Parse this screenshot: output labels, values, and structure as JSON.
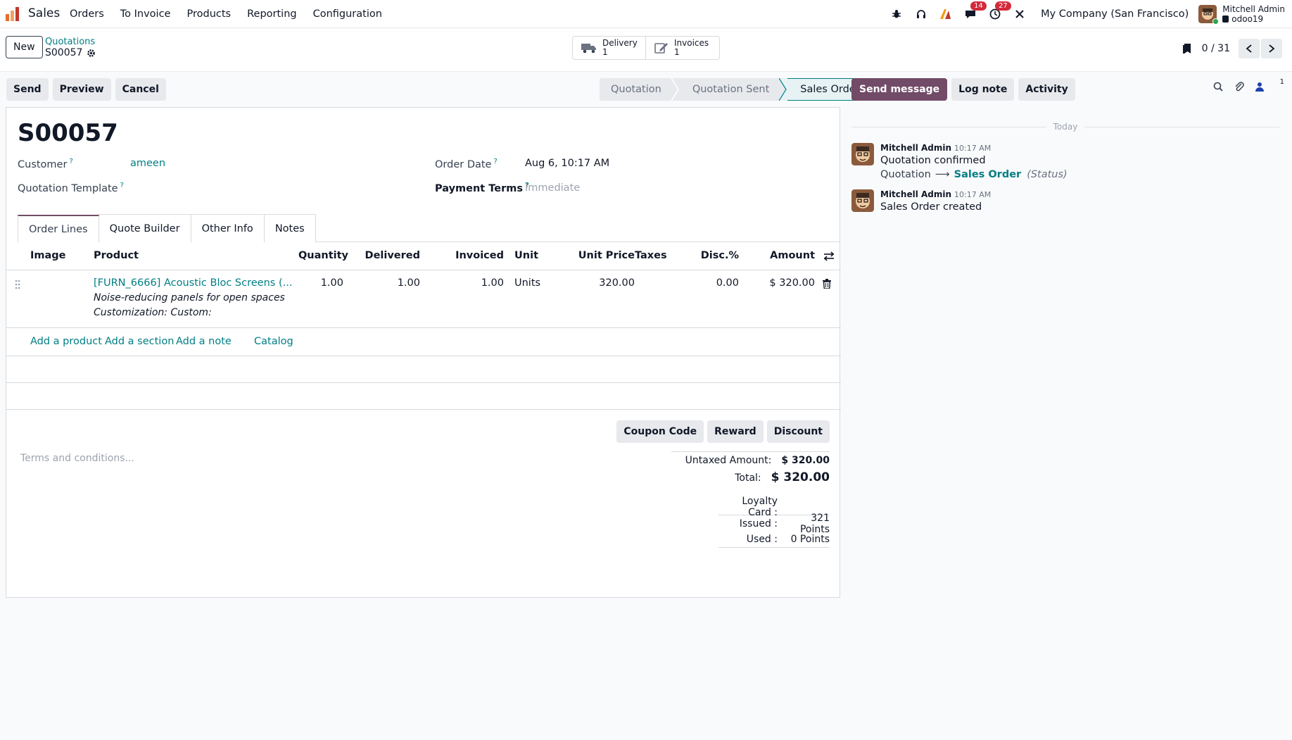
{
  "navbar": {
    "app_name": "Sales",
    "menu": [
      "Orders",
      "To Invoice",
      "Products",
      "Reporting",
      "Configuration"
    ],
    "messages_badge": "14",
    "activities_badge": "27",
    "company": "My Company (San Francisco)",
    "user_name": "Mitchell Admin",
    "user_db": "odoo19"
  },
  "control": {
    "new_label": "New",
    "breadcrumb_parent": "Quotations",
    "breadcrumb_current": "S00057",
    "smart_buttons": [
      {
        "label": "Delivery",
        "count": "1",
        "icon": "truck-icon"
      },
      {
        "label": "Invoices",
        "count": "1",
        "icon": "pencil-square-icon"
      }
    ],
    "pager": "0 / 31"
  },
  "actions": {
    "send": "Send",
    "preview": "Preview",
    "cancel": "Cancel"
  },
  "status": {
    "stages": [
      "Quotation",
      "Quotation Sent",
      "Sales Order"
    ],
    "active": "Sales Order"
  },
  "form": {
    "name": "S00057",
    "customer_label": "Customer",
    "customer": "ameen",
    "template_label": "Quotation Template",
    "order_date_label": "Order Date",
    "order_date": "Aug 6, 10:17 AM",
    "payment_terms_label": "Payment Terms",
    "payment_terms_placeholder": "Immediate",
    "help_mark": "?"
  },
  "tabs": [
    "Order Lines",
    "Quote Builder",
    "Other Info",
    "Notes"
  ],
  "table": {
    "headers": {
      "image": "Image",
      "product": "Product",
      "quantity": "Quantity",
      "delivered": "Delivered",
      "invoiced": "Invoiced",
      "unit": "Unit",
      "unit_price": "Unit Price",
      "taxes": "Taxes",
      "discount": "Disc.%",
      "amount": "Amount"
    },
    "line": {
      "product": "[FURN_6666] Acoustic Bloc Screens (...",
      "description": "Noise-reducing panels for open spaces",
      "customization": "Customization: Custom:",
      "quantity": "1.00",
      "delivered": "1.00",
      "invoiced": "1.00",
      "unit": "Units",
      "unit_price": "320.00",
      "discount": "0.00",
      "amount": "$ 320.00"
    },
    "add_links": {
      "product": "Add a product",
      "section": "Add a section",
      "note": "Add a note",
      "catalog": "Catalog"
    }
  },
  "promo_buttons": {
    "coupon": "Coupon Code",
    "reward": "Reward",
    "discount": "Discount"
  },
  "terms_placeholder": "Terms and conditions...",
  "totals": {
    "untaxed_label": "Untaxed Amount:",
    "untaxed": "$ 320.00",
    "total_label": "Total:",
    "total": "$ 320.00"
  },
  "loyalty": {
    "label": "Loyalty Card :",
    "issued_label": "Issued :",
    "issued": "321 Points",
    "used_label": "Used :",
    "used": "0 Points"
  },
  "chatter": {
    "send_message": "Send message",
    "log_note": "Log note",
    "activity": "Activity",
    "followers_count": "1",
    "today": "Today",
    "messages": [
      {
        "author": "Mitchell Admin",
        "time": "10:17 AM",
        "text": "Quotation confirmed",
        "tracking_old": "Quotation",
        "tracking_arrow": "⟶",
        "tracking_new": "Sales Order",
        "tracking_field": "(Status)"
      },
      {
        "author": "Mitchell Admin",
        "time": "10:17 AM",
        "text": "Sales Order created"
      }
    ]
  },
  "colors": {
    "brand": "#714b67",
    "link": "#017e84",
    "badge": "#d42a3a"
  }
}
